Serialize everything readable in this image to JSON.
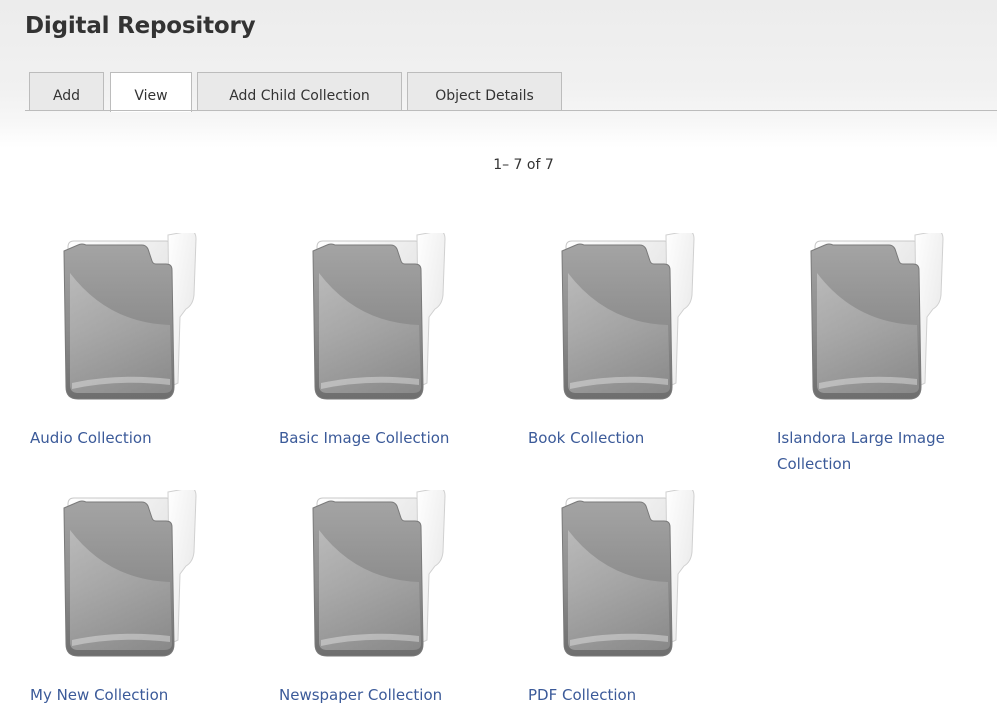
{
  "header": {
    "title": "Digital Repository"
  },
  "tabs": [
    {
      "label": "Add",
      "active": false
    },
    {
      "label": "View",
      "active": true
    },
    {
      "label": "Add Child Collection",
      "active": false
    },
    {
      "label": "Object Details",
      "active": false
    }
  ],
  "pager": {
    "text": "1– 7 of 7"
  },
  "collections": [
    {
      "label": "Audio Collection",
      "icon": "folder-icon"
    },
    {
      "label": "Basic Image Collection",
      "icon": "folder-icon"
    },
    {
      "label": "Book Collection",
      "icon": "folder-icon"
    },
    {
      "label": "Islandora Large Image Collection",
      "icon": "folder-icon"
    },
    {
      "label": "My New Collection",
      "icon": "folder-icon"
    },
    {
      "label": "Newspaper Collection",
      "icon": "folder-icon"
    },
    {
      "label": "PDF Collection",
      "icon": "folder-icon"
    }
  ],
  "colors": {
    "link": "#3b5a99",
    "tab_border": "#bcbcbc",
    "title_text": "#333333"
  }
}
